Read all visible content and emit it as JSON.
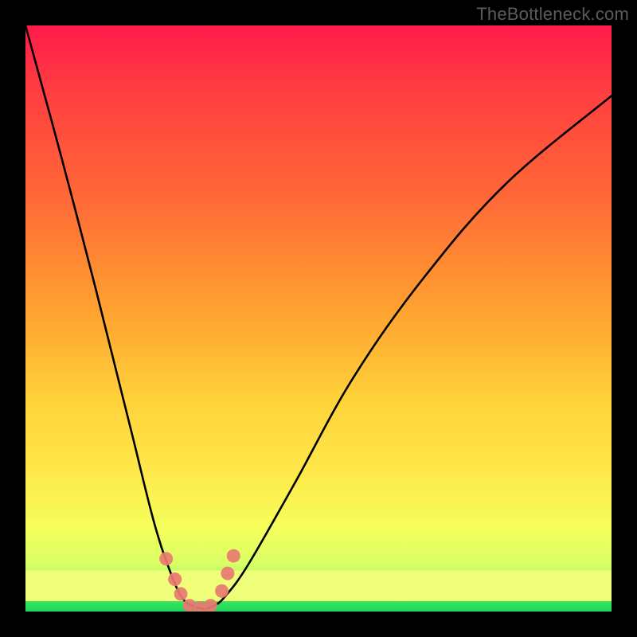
{
  "watermark": "TheBottleneck.com",
  "colors": {
    "background": "#000000",
    "curve_stroke": "#000000",
    "marker_fill": "#e97a71",
    "gradient_top": "#ff1a4a",
    "gradient_bottom": "#1ed760",
    "yellow_band": "#efff7a"
  },
  "chart_data": {
    "type": "line",
    "title": "",
    "xlabel": "",
    "ylabel": "",
    "xlim": [
      0,
      100
    ],
    "ylim": [
      0,
      100
    ],
    "grid": false,
    "legend": false,
    "annotations": [
      {
        "text": "TheBottleneck.com",
        "position": "top-right"
      }
    ],
    "series": [
      {
        "name": "bottleneck-curve",
        "x": [
          0,
          6,
          12,
          18,
          22,
          25,
          27,
          29,
          30.5,
          32,
          34,
          38,
          46,
          56,
          68,
          82,
          100
        ],
        "values": [
          100,
          78,
          55,
          31,
          15,
          6,
          2,
          0.8,
          0.5,
          0.9,
          2.5,
          8,
          22,
          40,
          57,
          73,
          88
        ]
      }
    ],
    "markers": [
      {
        "x": 24.0,
        "y": 9.0
      },
      {
        "x": 25.5,
        "y": 5.5
      },
      {
        "x": 26.5,
        "y": 3.0
      },
      {
        "x": 28.0,
        "y": 1.0
      },
      {
        "x": 29.8,
        "y": 0.6
      },
      {
        "x": 31.6,
        "y": 1.0
      },
      {
        "x": 33.5,
        "y": 3.5
      },
      {
        "x": 34.5,
        "y": 6.5
      },
      {
        "x": 35.5,
        "y": 9.5
      }
    ],
    "comment": "Values are read off the image in a 0–100 normalized coordinate space for both axes (x left→right, y bottom→top). The curve forms an asymmetric V with its minimum near x≈30."
  }
}
